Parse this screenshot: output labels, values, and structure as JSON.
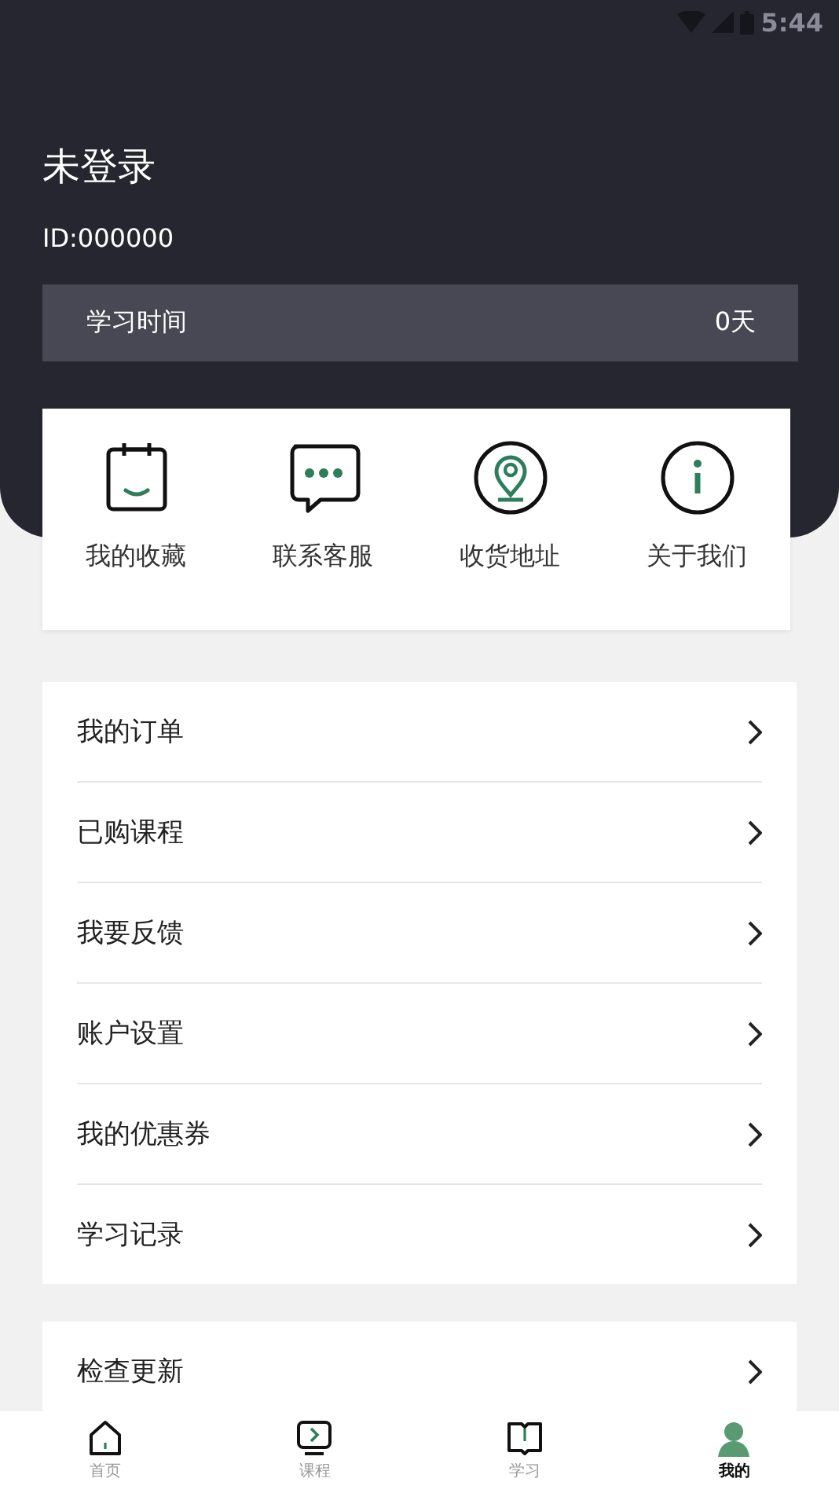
{
  "status_bar": {
    "time": "5:44"
  },
  "profile": {
    "name": "未登录",
    "id": "ID:000000",
    "study_time": {
      "label": "学习时间",
      "value": "0天"
    }
  },
  "shortcuts": [
    {
      "kind": "favorites",
      "label": "我的收藏"
    },
    {
      "kind": "service",
      "label": "联系客服"
    },
    {
      "kind": "address",
      "label": "收货地址"
    },
    {
      "kind": "about",
      "label": "关于我们"
    }
  ],
  "menu": [
    "我的订单",
    "已购课程",
    "我要反馈",
    "账户设置",
    "我的优惠券",
    "学习记录"
  ],
  "menu_2": [
    "检查更新"
  ],
  "tabs": [
    {
      "kind": "home",
      "label": "首页",
      "selected": false
    },
    {
      "kind": "courses",
      "label": "课程",
      "selected": false
    },
    {
      "kind": "study",
      "label": "学习",
      "selected": false
    },
    {
      "kind": "me",
      "label": "我的",
      "selected": true
    }
  ]
}
